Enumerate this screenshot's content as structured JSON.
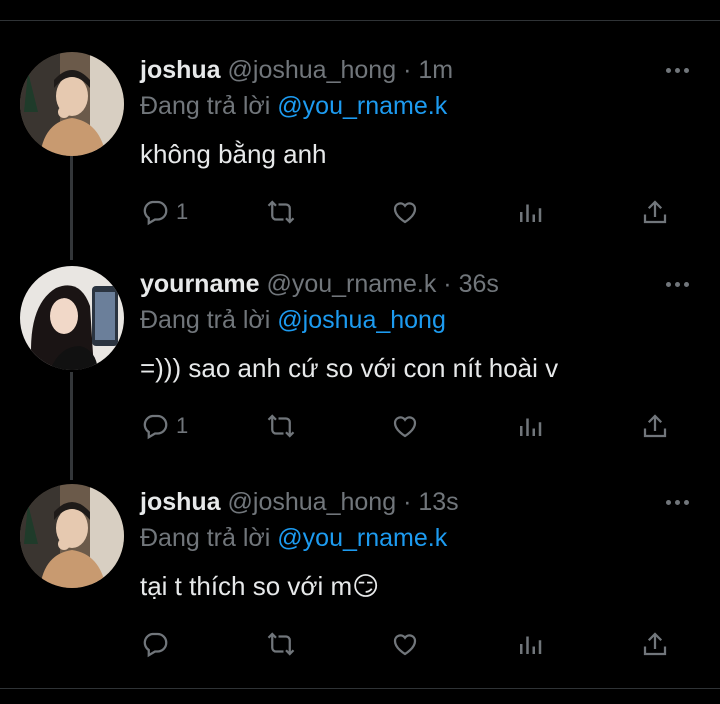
{
  "tweets": [
    {
      "name": "joshua",
      "handle": "@joshua_hong",
      "dot": "·",
      "time": "1m",
      "replying_prefix": "Đang trả lời",
      "replying_to": "@you_rname.k",
      "text": "không bằng anh",
      "reply_count": "1"
    },
    {
      "name": "yourname",
      "handle": "@you_rname.k",
      "dot": "·",
      "time": "36s",
      "replying_prefix": "Đang trả lời",
      "replying_to": "@joshua_hong",
      "text": "=))) sao anh cứ so với con nít hoài v",
      "reply_count": "1"
    },
    {
      "name": "joshua",
      "handle": "@joshua_hong",
      "dot": "·",
      "time": "13s",
      "replying_prefix": "Đang trả lời",
      "replying_to": "@you_rname.k",
      "text": "tại t thích so với m😏",
      "reply_count": ""
    }
  ],
  "icons": {
    "reply": "reply-icon",
    "retweet": "retweet-icon",
    "like": "heart-icon",
    "views": "analytics-icon",
    "share": "share-icon",
    "more": "more-icon"
  },
  "colors": {
    "background": "#000000",
    "text": "#e7e9ea",
    "muted": "#71767b",
    "link": "#1d9bf0",
    "thread_line": "#333639"
  }
}
